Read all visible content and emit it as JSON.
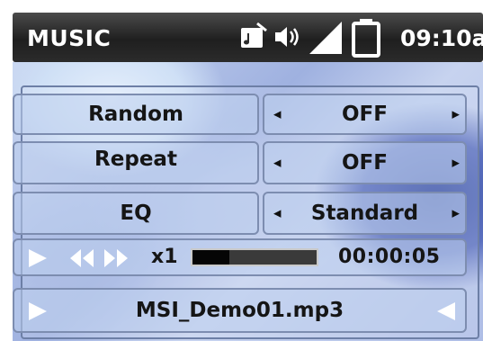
{
  "status_bar": {
    "title": "MUSIC",
    "clock": "09:10a",
    "icons": [
      "music-mode-icon",
      "volume-icon",
      "signal-icon",
      "battery-icon"
    ]
  },
  "settings": [
    {
      "label": "Random",
      "value": "OFF"
    },
    {
      "label": "Repeat",
      "value": "OFF"
    },
    {
      "label": "EQ",
      "value": "Standard"
    }
  ],
  "arrows": {
    "left": "◀",
    "right": "▶"
  },
  "player": {
    "speed": "x1",
    "progress": 0.3,
    "elapsed": "00:00:05",
    "controls": [
      "play-icon",
      "rewind-icon",
      "fast-forward-icon"
    ]
  },
  "file": {
    "name": "MSI_Demo01.mp3"
  },
  "colors": {
    "status_bar_bg": "#2b2b2b",
    "text": "#151515",
    "cell_border": "#7d8db0",
    "progress_fill": "#050505"
  }
}
